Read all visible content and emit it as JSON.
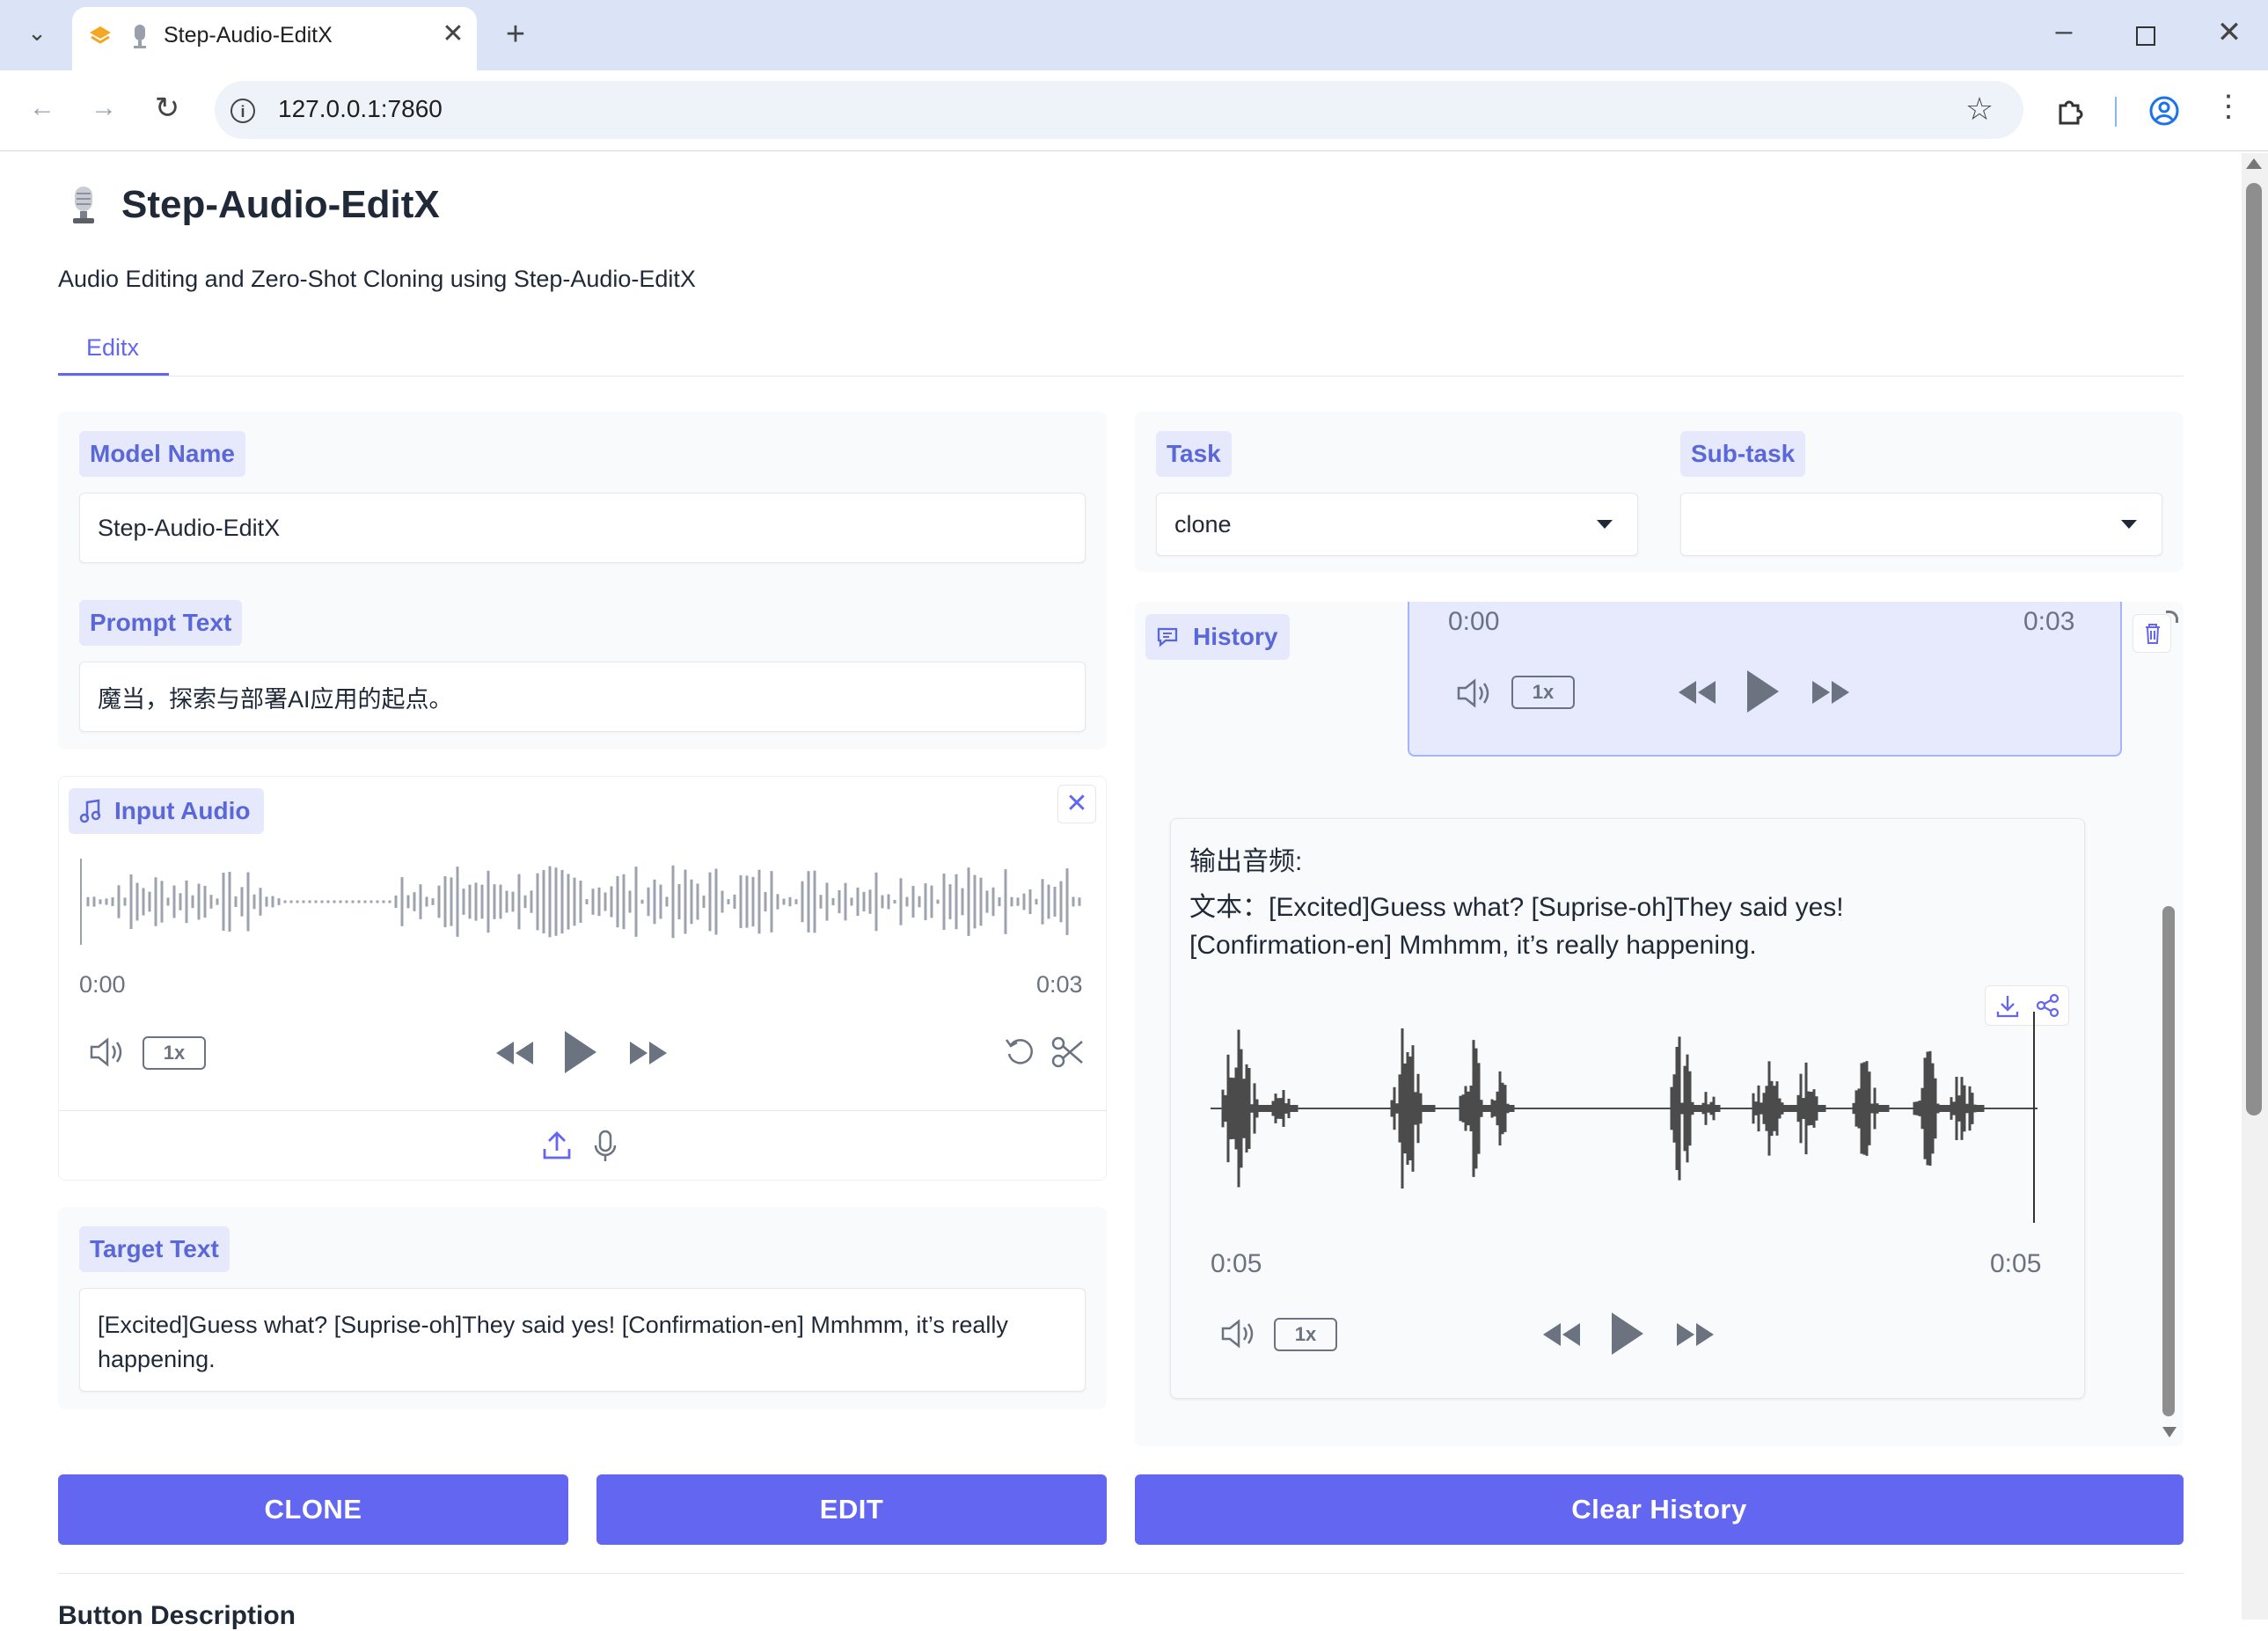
{
  "browser": {
    "tab_title": "Step-Audio-EditX",
    "url": "127.0.0.1:7860"
  },
  "app": {
    "title": "Step-Audio-EditX",
    "subtitle": "Audio Editing and Zero-Shot Cloning using Step-Audio-EditX",
    "tab": "Editx"
  },
  "model": {
    "label": "Model Name",
    "value": "Step-Audio-EditX"
  },
  "prompt": {
    "label": "Prompt Text",
    "value": "魔当，探索与部署AI应用的起点。"
  },
  "input_audio": {
    "label": "Input Audio",
    "time_start": "0:00",
    "time_end": "0:03",
    "speed": "1x"
  },
  "target": {
    "label": "Target Text",
    "value": "[Excited]Guess what? [Suprise-oh]They said yes! [Confirmation-en] Mmhmm, it’s really happening."
  },
  "task": {
    "label": "Task",
    "value": "clone"
  },
  "subtask": {
    "label": "Sub-task",
    "value": ""
  },
  "history": {
    "label": "History",
    "prev_audio": {
      "time_start": "0:00",
      "time_end": "0:03",
      "speed": "1x"
    },
    "output_title": "输出音频:",
    "output_text_line1": "文本：[Excited]Guess what? [Suprise-oh]They said yes!",
    "output_text_line2": "[Confirmation-en] Mmhmm, it’s really happening.",
    "output_audio": {
      "time_start": "0:05",
      "time_end": "0:05",
      "speed": "1x"
    }
  },
  "buttons": {
    "clone": "CLONE",
    "edit": "EDIT",
    "clear": "Clear History"
  },
  "footer_partial": "Button Description",
  "colors": {
    "accent": "#6366f1",
    "label_bg": "#e6e9fb",
    "label_text": "#5a67d8"
  }
}
